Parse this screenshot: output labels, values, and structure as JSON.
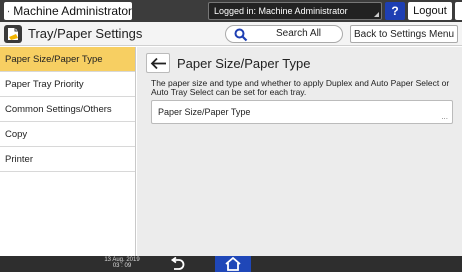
{
  "topbar": {
    "user_name": "Machine Administrator",
    "logged_in_text": "Logged in: Machine Administrator",
    "help_label": "?",
    "logout_label": "Logout"
  },
  "titlebar": {
    "app_title": "Tray/Paper Settings",
    "search_label": "Search All",
    "back_to_settings_label": "Back to Settings Menu"
  },
  "sidebar": {
    "items": [
      {
        "label": "Paper Size/Paper Type"
      },
      {
        "label": "Paper Tray Priority"
      },
      {
        "label": "Common Settings/Others"
      },
      {
        "label": "Copy"
      },
      {
        "label": "Printer"
      }
    ]
  },
  "main": {
    "page_title": "Paper Size/Paper Type",
    "description": "The paper size and type and whether to apply Duplex and Auto Paper Select or Auto Tray Select can be set for each tray.",
    "setting_label": "Paper Size/Paper Type",
    "setting_more": "..."
  },
  "bottombar": {
    "date_line1": "13 Aug. 2019",
    "date_line2": "03 : 09"
  },
  "colors": {
    "active_item": "#f7cf62",
    "home_button": "#1f47b8",
    "help_button": "#1e3fb3",
    "topbar": "#3c3c3c"
  },
  "icons": {
    "user": "user-icon",
    "app": "tray-paper-icon",
    "search": "search-icon",
    "back": "back-arrow-icon",
    "home": "home-icon",
    "energy": "moon-icon"
  }
}
